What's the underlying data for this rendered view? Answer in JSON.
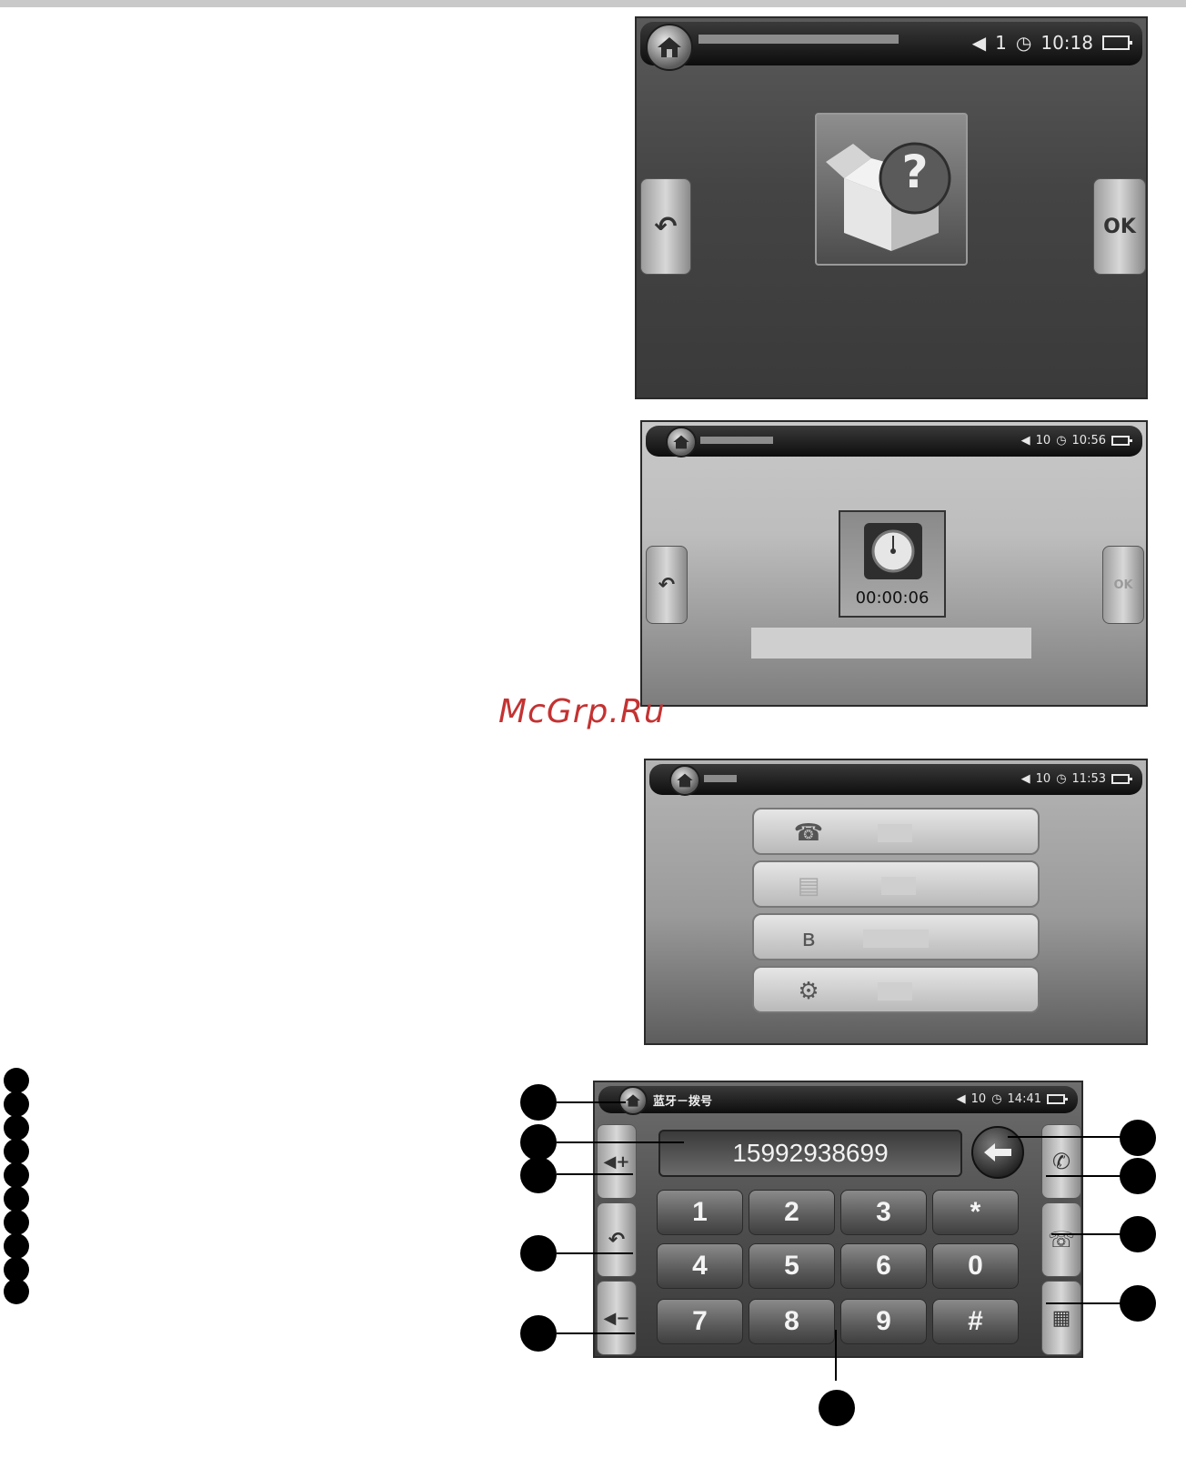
{
  "screen1": {
    "volume": "1",
    "time": "10:18",
    "ok_label": "OK",
    "box_symbol": "?"
  },
  "screen2": {
    "volume": "10",
    "time": "10:56",
    "ok_label": "OK",
    "timer": "00:00:06"
  },
  "watermark": "McGrp.Ru",
  "screen3": {
    "volume": "10",
    "time": "11:53"
  },
  "screen4": {
    "title": "蓝牙－拨号",
    "volume": "10",
    "time": "14:41",
    "number": "15992938699",
    "keys": [
      "1",
      "2",
      "3",
      "*",
      "4",
      "5",
      "6",
      "0",
      "7",
      "8",
      "9",
      "#"
    ]
  },
  "icons": {
    "home": "home-icon",
    "volume": "speaker-icon",
    "clock": "clock-icon",
    "battery": "battery-icon",
    "back": "undo-arrow-icon",
    "help_box": "question-box-icon",
    "timer": "dial-icon",
    "backspace": "left-arrow-icon",
    "call": "phone-pickup-icon",
    "hangup": "phone-hangup-icon",
    "keypad": "keypad-icon",
    "vol_up": "volume-up-icon",
    "vol_down": "volume-down-icon"
  },
  "colors": {
    "watermark": "#c43232",
    "callout": "#000000"
  }
}
